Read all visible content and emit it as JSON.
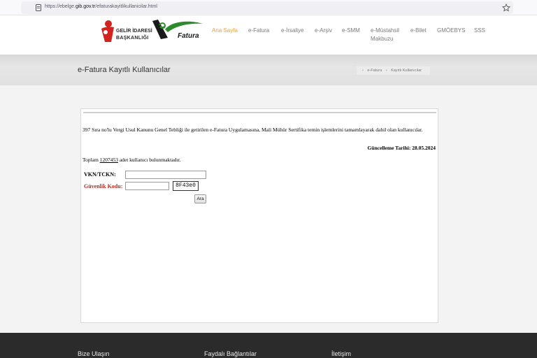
{
  "browser": {
    "url_prefix": "https://ebelge.",
    "url_domain": "gib.gov.tr",
    "url_path": "/efaturakayitlikullanicilar.html",
    "icons": [
      "shield-icon",
      "page-icon",
      "bookmark-star-icon"
    ]
  },
  "header": {
    "logo_line1": "GELİR İDARESİ",
    "logo_line2": "BAŞKANLIĞI",
    "efatura_logo_text": "Fatura",
    "nav": [
      {
        "label": "Ana Sayfa",
        "active": true
      },
      {
        "label": "e-Fatura"
      },
      {
        "label": "e-İrsaliye"
      },
      {
        "label": "e-Arşiv"
      },
      {
        "label": "e-SMM"
      },
      {
        "label": "e-Müstahsil",
        "label2": "Makbuzu"
      },
      {
        "label": "e-Bilet"
      },
      {
        "label": "GMÖEBYS"
      },
      {
        "label": "SSS"
      }
    ]
  },
  "title_band": {
    "title": "e-Fatura Kayıtlı Kullanıcılar",
    "breadcrumb": [
      "e-Fatura",
      "Kayıtlı Kullanıcılar"
    ]
  },
  "content": {
    "intro": "397 Sıra no'lu Vergi Usul Kanunu Genel Tebliği ile getirilen e-Fatura Uygulamasına, Mali Mühür Sertifika temin işlemlerini tamamlayarak dahil olan kullanıcılar.",
    "updated": "Güncelleme Tarihi: 28.05.2024",
    "total_prefix": "Toplam",
    "total_count": "1207453",
    "total_suffix": "adet kullanıcı bulunmaktadır.",
    "vkn_label": "VKN/TCKN:",
    "vkn_value": "",
    "security_label": "Güvenlik Kodu:",
    "security_value": "",
    "captcha": "8F43e0",
    "search_button": "Ara"
  },
  "footer": {
    "headings": [
      "Bize Ulaşın",
      "Faydalı Bağlantılar",
      "İletişim"
    ]
  },
  "colors": {
    "nav_active": "#e6a23c",
    "nav_default": "#7a7a7a",
    "security_label": "#c0281f",
    "footer_bg": "#2b2b2b",
    "gib_red": "#d2231f",
    "efatura_green": "#2d8a2d"
  }
}
